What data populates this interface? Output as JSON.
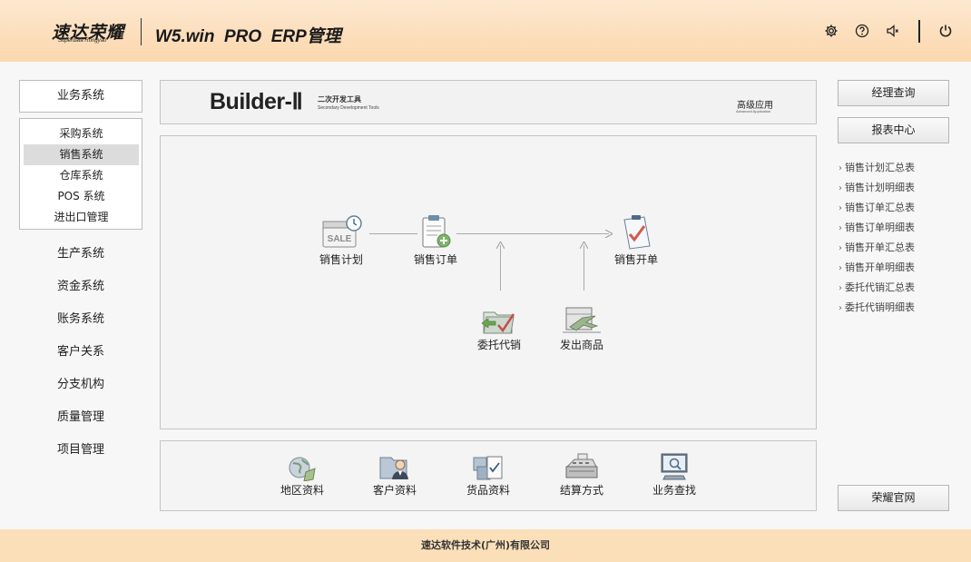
{
  "header": {
    "logo_cn": "速达荣耀",
    "logo_en": "Superdata Rongyao",
    "product": "W5.win  PRO  ERP管理",
    "icons": [
      "gear-icon",
      "help-icon",
      "speaker-icon",
      "power-icon"
    ]
  },
  "left_nav": {
    "top_button": "业务系统",
    "sub_items": [
      "采购系统",
      "销售系统",
      "仓库系统",
      "POS 系统",
      "进出口管理"
    ],
    "active_sub": "销售系统",
    "items": [
      "生产系统",
      "资金系统",
      "账务系统",
      "客户关系",
      "分支机构",
      "质量管理",
      "项目管理"
    ]
  },
  "banner": {
    "title": "Builder-Ⅱ",
    "sub_cn": "二次开发工具",
    "sub_en": "Secondary Development Tools",
    "right_cn": "高级应用",
    "right_en": "Advanced Application"
  },
  "flow": {
    "nodes": [
      "销售计划",
      "销售订单",
      "销售开单",
      "委托代销",
      "发出商品"
    ],
    "sale_badge": "SALE"
  },
  "bottom_tools": [
    "地区资料",
    "客户资料",
    "货品资料",
    "结算方式",
    "业务查找"
  ],
  "right_panel": {
    "btn_manager": "经理查询",
    "btn_reports": "报表中心",
    "reports": [
      "销售计划汇总表",
      "销售计划明细表",
      "销售订单汇总表",
      "销售订单明细表",
      "销售开单汇总表",
      "销售开单明细表",
      "委托代销汇总表",
      "委托代销明细表"
    ],
    "btn_website": "荣耀官网"
  },
  "footer": {
    "text": "速达软件技术(广州)有限公司"
  },
  "colors": {
    "header_bg": "#fbd7ad",
    "footer_bg": "#fbdfb9",
    "active_bg": "#dcdcdc"
  }
}
